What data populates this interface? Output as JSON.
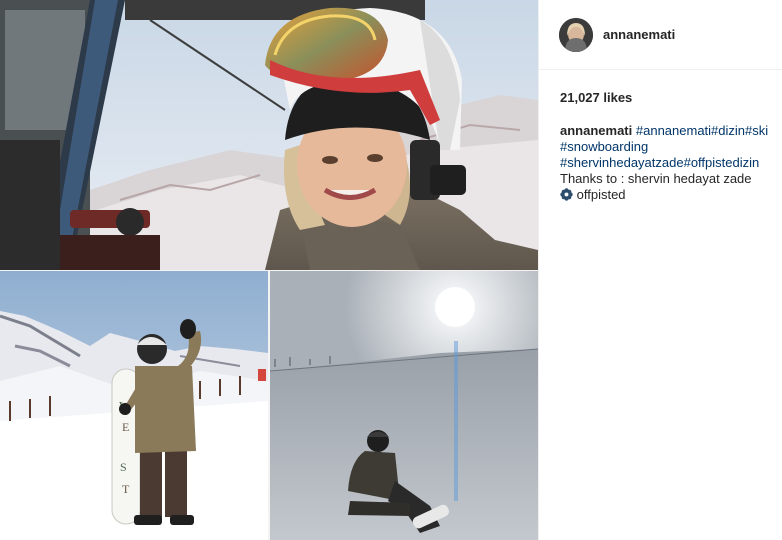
{
  "post": {
    "username": "annanemati",
    "likes_text": "21,027 likes",
    "caption": {
      "username": "annanemati",
      "tag_line1": [
        "#annanemati",
        "#dizin",
        "#ski"
      ],
      "tag_line2": "#snowboarding",
      "tag_line3": [
        "#shervinhedayatzade",
        "#offpistedizin"
      ],
      "thanks_text": "Thanks to : shervin hedayat zade",
      "icon": "snowflake-flower-icon",
      "offpisted_text": "offpisted"
    }
  },
  "colors": {
    "hashtag": "#003569",
    "text": "#262626",
    "border": "#efefef"
  }
}
